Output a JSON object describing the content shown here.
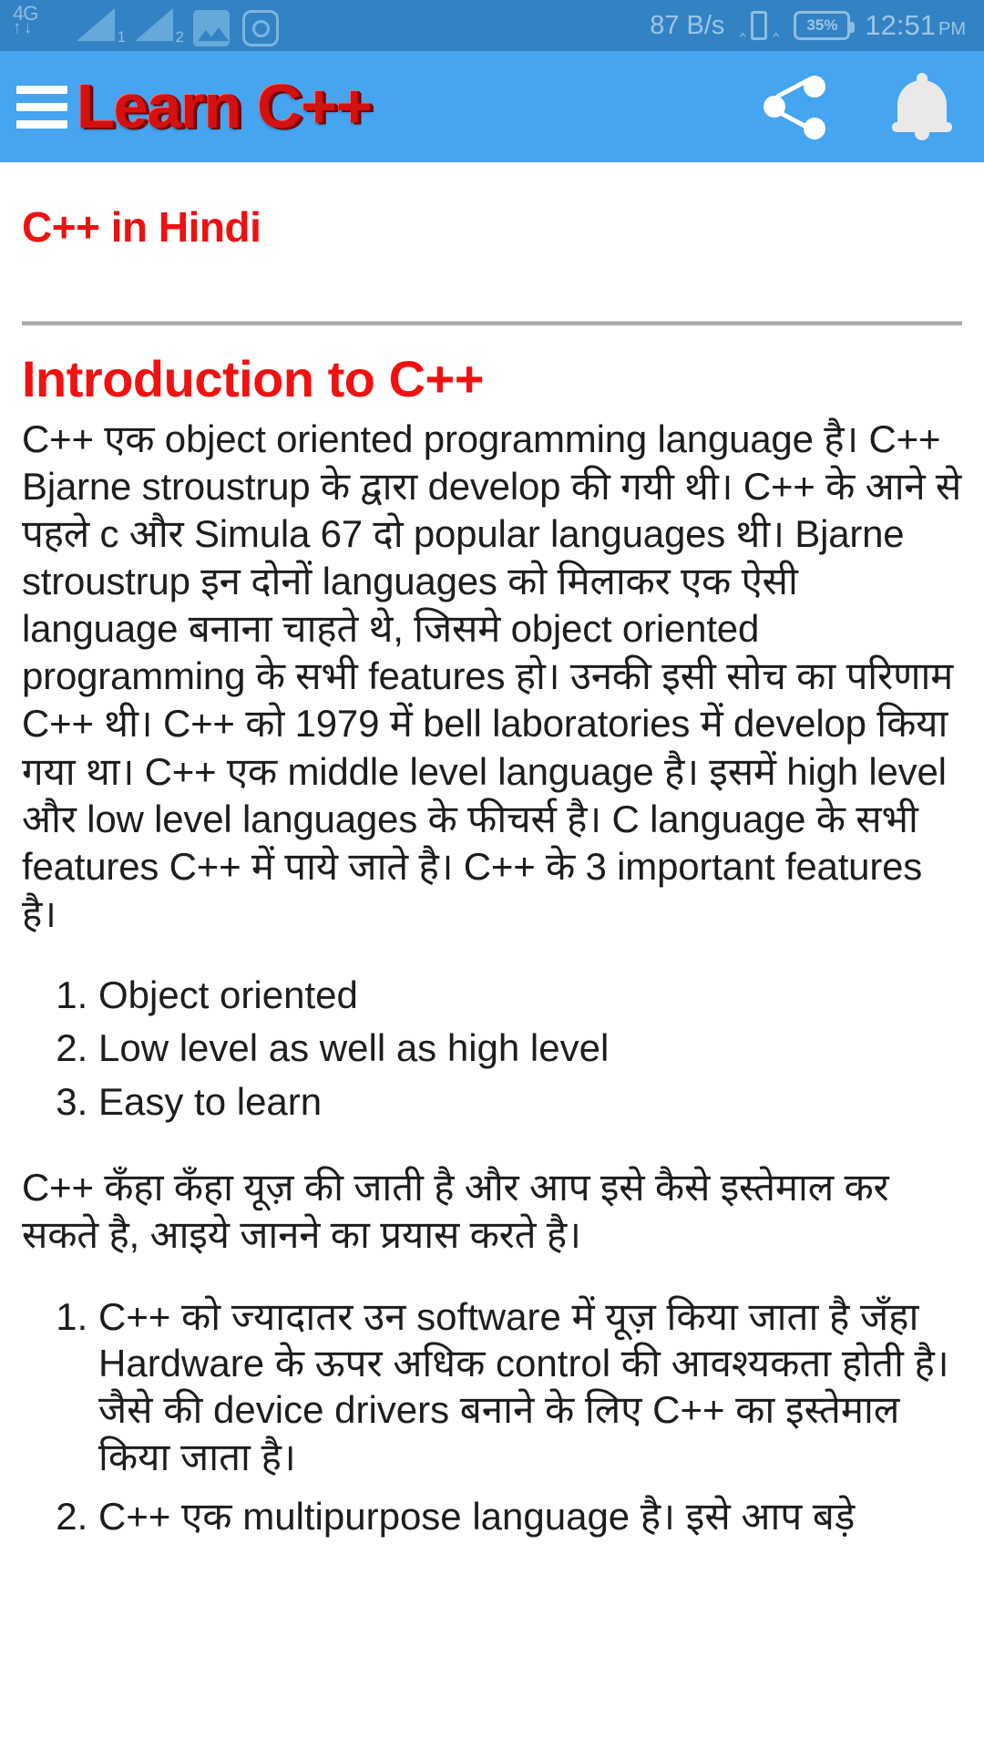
{
  "status_bar": {
    "network_type": "4G",
    "sim1_label": "1",
    "sim2_label": "2",
    "gallery_icon": "gallery-icon",
    "camera_icon": "camera-icon",
    "net_speed": "87 B/s",
    "vibrate_icon": "vibrate-icon",
    "battery_percent": "35%",
    "time": "12:51",
    "am_pm": "PM",
    "background_color": "#3382c4",
    "text_color": "#9cc6e6"
  },
  "app_bar": {
    "menu_icon": "hamburger-menu-icon",
    "logo_text": "Learn C++",
    "share_icon": "share-icon",
    "notification_icon": "bell-icon",
    "background_color": "#45a5f0",
    "logo_color": "#d41111"
  },
  "content": {
    "page_title": "C++ in Hindi",
    "page_title_color": "#ee1111",
    "section_title": "Introduction to C++",
    "section_title_color": "#f21010",
    "paragraph_1": "C++ एक object oriented programming language है। C++ Bjarne stroustrup के द्वारा develop की गयी थी। C++ के आने से पहले c और Simula 67 दो popular languages थी। Bjarne stroustrup इन दोनों languages को मिलाकर एक ऐसी language बनाना चाहते थे, जिसमे object oriented programming के सभी features हो। उनकी इसी सोच का परिणाम C++ थी। C++ को 1979 में bell laboratories में develop किया गया था। C++ एक middle level language है। इसमें high level और low level languages के फीचर्स है। C language के सभी features C++ में पाये जाते है। C++ के 3 important features है।",
    "features_list": [
      "Object oriented",
      "Low level as well as high level",
      "Easy to learn"
    ],
    "paragraph_2": "C++ कँहा कँहा यूज़ की जाती है और आप इसे कैसे इस्तेमाल कर सकते है, आइये जानने का प्रयास करते है।",
    "usage_list": [
      "C++ को ज्यादातर उन software में यूज़ किया जाता है जँहा Hardware के ऊपर अधिक control की आवश्यकता होती है। जैसे की device drivers बनाने के लिए C++ का इस्तेमाल किया जाता है।",
      "C++ एक multipurpose language है। इसे आप बड़े"
    ]
  }
}
